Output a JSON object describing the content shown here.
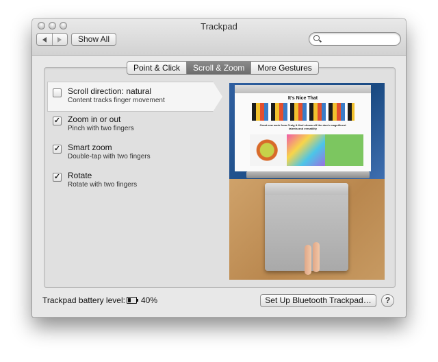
{
  "window": {
    "title": "Trackpad"
  },
  "toolbar": {
    "show_all_label": "Show All",
    "search_placeholder": "",
    "search_icon": "magnifier"
  },
  "tabs": [
    {
      "label": "Point & Click",
      "active": false
    },
    {
      "label": "Scroll & Zoom",
      "active": true
    },
    {
      "label": "More Gestures",
      "active": false
    }
  ],
  "options": [
    {
      "title": "Scroll direction: natural",
      "subtitle": "Content tracks finger movement",
      "checked": false,
      "selected": true
    },
    {
      "title": "Zoom in or out",
      "subtitle": "Pinch with two fingers",
      "checked": true,
      "selected": false
    },
    {
      "title": "Smart zoom",
      "subtitle": "Double-tap with two fingers",
      "checked": true,
      "selected": false
    },
    {
      "title": "Rotate",
      "subtitle": "Rotate with two fingers",
      "checked": true,
      "selected": false
    }
  ],
  "preview": {
    "site_title": "It's Nice That",
    "headline": "Great new work from Craig & Karl shows off the duo's magnificent talents and versatility"
  },
  "footer": {
    "battery_label": "Trackpad battery level:",
    "battery_percent": "40%",
    "battery_level": 0.4,
    "setup_button_label": "Set Up Bluetooth Trackpad…",
    "help_button_label": "?"
  },
  "colors": {
    "active_tab": "#767676",
    "selected_row": "#f5f5f5",
    "window_bg": "#e8e8e8"
  }
}
